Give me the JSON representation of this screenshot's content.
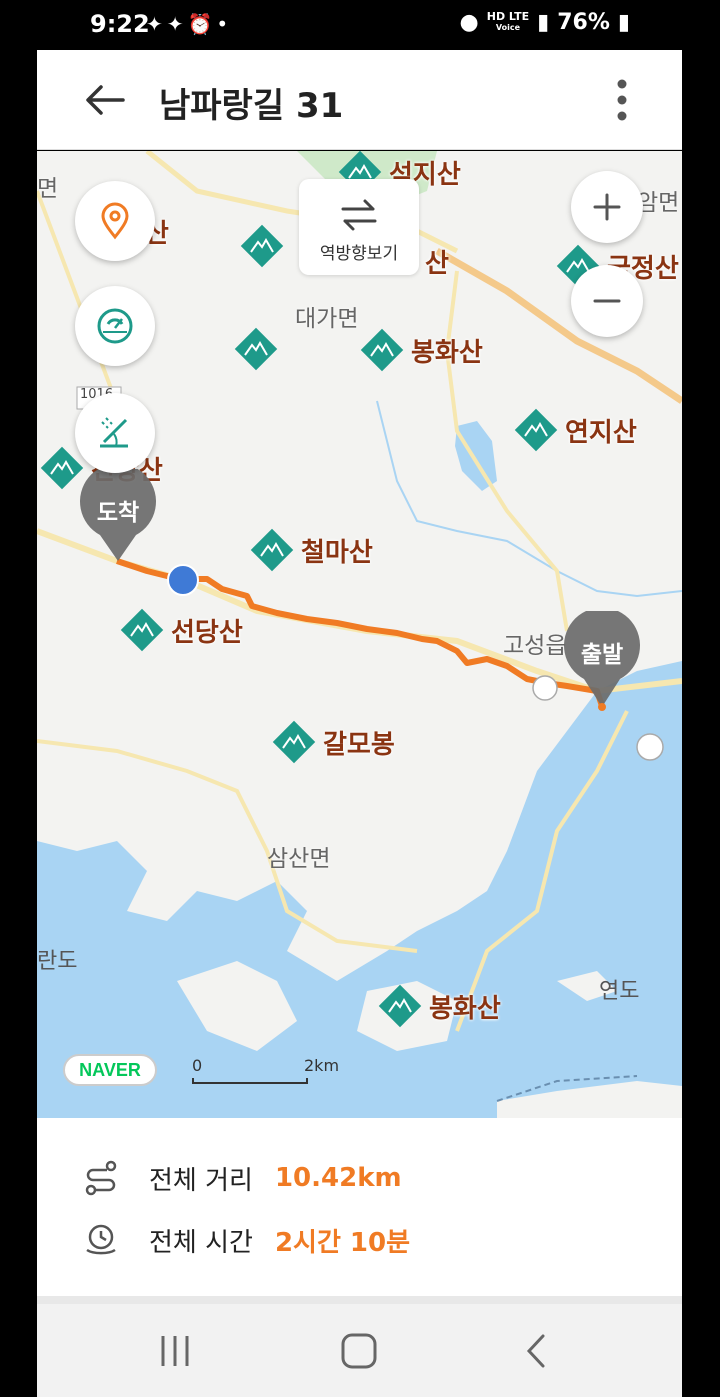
{
  "status_bar": {
    "time": "9:22",
    "network_top": "HD LTE",
    "network_bottom": "Voice",
    "battery": "76%"
  },
  "app_bar": {
    "title": "남파랑길 31"
  },
  "map": {
    "reverse_button_label": "역방향보기",
    "markers": {
      "arrival": "도착",
      "departure": "출발"
    },
    "pois": [
      {
        "name": "석지산"
      },
      {
        "name": "석장산"
      },
      {
        "name": "봉화산"
      },
      {
        "name": "연지산"
      },
      {
        "name": "철마산"
      },
      {
        "name": "선당산"
      },
      {
        "name": "갈모봉"
      },
      {
        "name": "봉화산"
      },
      {
        "name": "국정산"
      },
      {
        "name": "천왕산"
      },
      {
        "name": "산"
      }
    ],
    "areas": {
      "daega": "대가면",
      "samsan": "삼산면",
      "goseong": "고성읍",
      "edge_top_left": "면",
      "edge_top_right": "암면",
      "road_number": "1016"
    },
    "water": {
      "yeondo": "연도",
      "rando": "란도"
    },
    "logo": "NAVER",
    "scale": {
      "zero": "0",
      "max": "2km"
    },
    "route_color": "#f07b24",
    "water_color": "#a9d4f3"
  },
  "info": {
    "distance_label": "전체 거리",
    "distance_value": "10.42km",
    "time_label": "전체 시간",
    "time_value": "2시간 10분"
  }
}
